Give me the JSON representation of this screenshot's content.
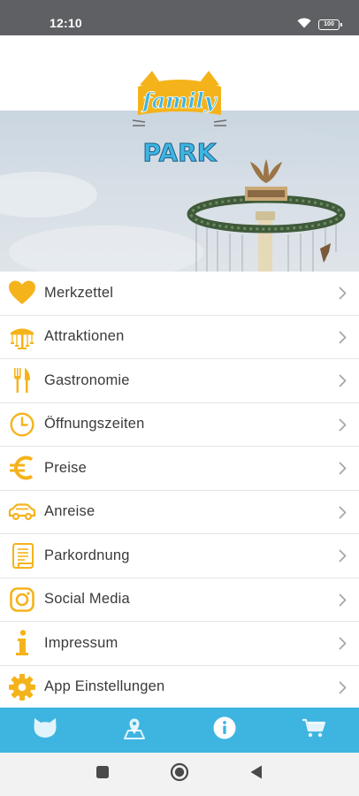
{
  "status": {
    "time": "12:10",
    "battery": "100"
  },
  "logo": {
    "line1": "family",
    "line2": "PARK"
  },
  "menu": [
    {
      "label": "Merkzettel",
      "icon": "heart-icon"
    },
    {
      "label": "Attraktionen",
      "icon": "carousel-icon"
    },
    {
      "label": "Gastronomie",
      "icon": "fork-knife-icon"
    },
    {
      "label": "Öffnungszeiten",
      "icon": "clock-icon"
    },
    {
      "label": "Preise",
      "icon": "euro-icon"
    },
    {
      "label": "Anreise",
      "icon": "car-icon"
    },
    {
      "label": "Parkordnung",
      "icon": "scroll-document-icon"
    },
    {
      "label": "Social Media",
      "icon": "instagram-icon"
    },
    {
      "label": "Impressum",
      "icon": "info-icon"
    },
    {
      "label": "App Einstellungen",
      "icon": "gear-icon"
    }
  ],
  "bottom_nav": [
    "cat-face-icon",
    "map-pin-icon",
    "info-circle-icon",
    "shopping-cart-icon"
  ],
  "colors": {
    "accent": "#f5b31b",
    "nav_bg": "#3eb5e0",
    "status_bg": "#5f6064"
  }
}
